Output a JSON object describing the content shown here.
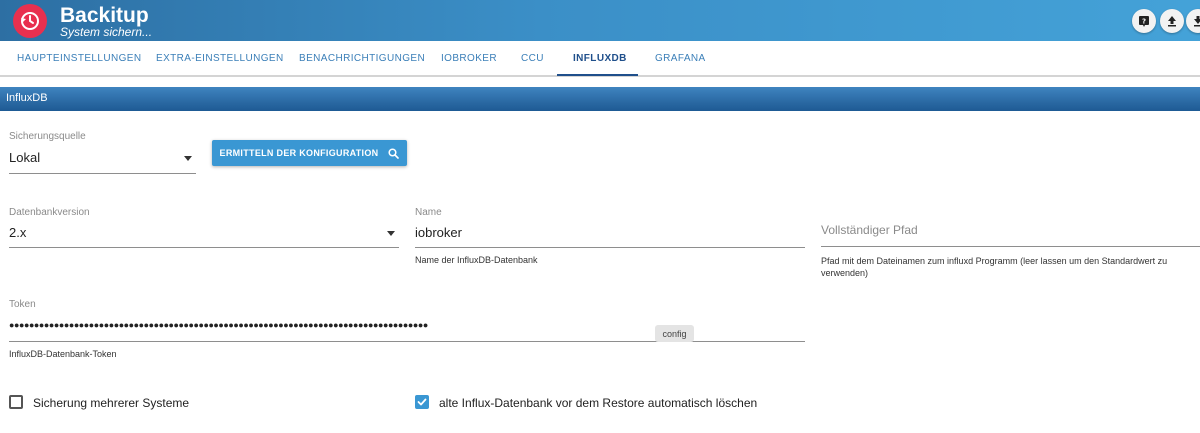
{
  "app": {
    "title": "Backitup",
    "subtitle": "System sichern..."
  },
  "header_buttons": [
    {
      "icon": "help-icon"
    },
    {
      "icon": "upload-icon"
    },
    {
      "icon": "download-icon"
    }
  ],
  "tabs": [
    {
      "label": "HAUPTEINSTELLUNGEN",
      "active": false
    },
    {
      "label": "EXTRA-EINSTELLUNGEN",
      "active": false
    },
    {
      "label": "BENACHRICHTIGUNGEN",
      "active": false
    },
    {
      "label": "IOBROKER",
      "active": false
    },
    {
      "label": "CCU",
      "active": false
    },
    {
      "label": "INFLUXDB",
      "active": true
    },
    {
      "label": "GRAFANA",
      "active": false
    }
  ],
  "section": {
    "title": "InfluxDB"
  },
  "form": {
    "source": {
      "label": "Sicherungsquelle",
      "value": "Lokal"
    },
    "detect_button": {
      "label": "ERMITTELN DER KONFIGURATION",
      "icon": "search-icon"
    },
    "db_version": {
      "label": "Datenbankversion",
      "value": "2.x"
    },
    "name": {
      "label": "Name",
      "value": "iobroker",
      "helper": "Name der InfluxDB-Datenbank"
    },
    "path": {
      "placeholder": "Vollständiger Pfad",
      "helper": "Pfad mit dem Dateinamen zum influxd Programm (leer lassen um den Standardwert zu verwenden)"
    },
    "token": {
      "label": "Token",
      "value": "●●●●●●●●●●●●●●●●●●●●●●●●●●●●●●●●●●●●●●●●●●●●●●●●●●●●●●●●●●●●●●●●●●●●●●●●●●●●●●●●●●●●",
      "helper": "InfluxDB-Datenbank-Token",
      "tooltip": "config"
    },
    "multi_system": {
      "label": "Sicherung mehrerer Systeme",
      "checked": false
    },
    "auto_delete": {
      "label": "alte Influx-Datenbank vor dem Restore automatisch löschen",
      "checked": true
    }
  },
  "colors": {
    "accent": "#3a97d3",
    "header": "#3b8fc7",
    "active_tab": "#1f4f8b",
    "logo": "#e8304f"
  }
}
